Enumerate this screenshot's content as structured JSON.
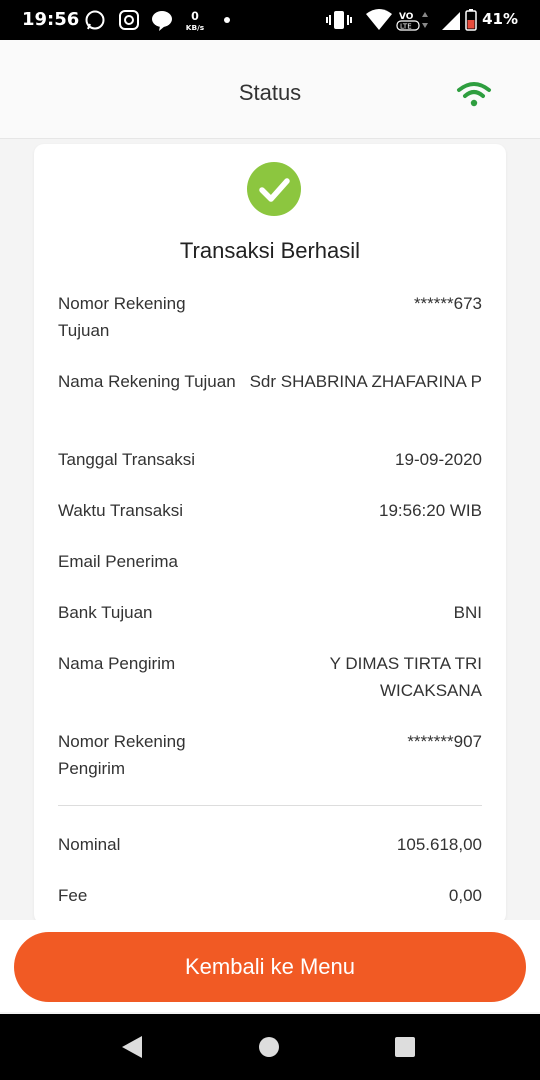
{
  "status_bar": {
    "time": "19:56",
    "net_speed": "0 KB/s",
    "battery": "41%"
  },
  "app_bar": {
    "title": "Status",
    "wifi_icon": "wifi-icon"
  },
  "receipt": {
    "status_title": "Transaksi Berhasil",
    "status_color": "#8cc63f",
    "rows": [
      {
        "label": "Nomor Rekening Tujuan",
        "value": "******673"
      },
      {
        "label": "Nama Rekening Tujuan",
        "value": "Sdr SHABRINA ZHAFARINA P"
      },
      {
        "label": "Tanggal Transaksi",
        "value": "19-09-2020"
      },
      {
        "label": "Waktu Transaksi",
        "value": "19:56:20 WIB"
      },
      {
        "label": "Email Penerima",
        "value": ""
      },
      {
        "label": "Bank Tujuan",
        "value": "BNI"
      },
      {
        "label": "Nama Pengirim",
        "value": "Y DIMAS TIRTA TRI WICAKSANA"
      },
      {
        "label": "Nomor Rekening Pengirim",
        "value": "*******907"
      }
    ],
    "totals": [
      {
        "label": "Nominal",
        "value": "105.618,00"
      },
      {
        "label": "Fee",
        "value": "0,00"
      }
    ]
  },
  "back_button": {
    "label": "Kembali ke Menu",
    "color": "#f15a24"
  }
}
